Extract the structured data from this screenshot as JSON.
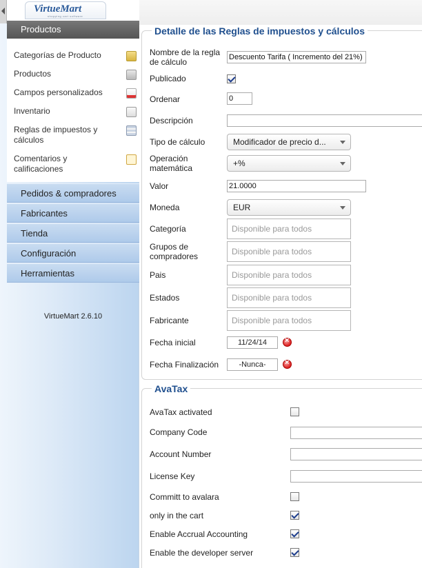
{
  "brand": {
    "name": "VirtueMart",
    "tagline": "shopping cart software"
  },
  "sidebar": {
    "section": "Productos",
    "submenu": [
      {
        "label": "Categorías de Producto",
        "icon": "folder-icon"
      },
      {
        "label": "Productos",
        "icon": "camera-icon"
      },
      {
        "label": "Campos personalizados",
        "icon": "custom-fields-icon"
      },
      {
        "label": "Inventario",
        "icon": "chart-icon"
      },
      {
        "label": "Reglas de impuestos y cálculos",
        "icon": "calculator-icon"
      },
      {
        "label": "Comentarios y calificaciones",
        "icon": "comment-bubble-icon"
      }
    ],
    "nav": [
      "Pedidos & compradores",
      "Fabricantes",
      "Tienda",
      "Configuración",
      "Herramientas"
    ],
    "version": "VirtueMart 2.6.10"
  },
  "rules": {
    "legend": "Detalle de las Reglas de impuestos y cálculos",
    "name_label": "Nombre de la regla de cálculo",
    "name_value": "Descuento Tarifa ( Incremento del 21%)",
    "published_label": "Publicado",
    "published": true,
    "order_label": "Ordenar",
    "order_value": "0",
    "description_label": "Descripción",
    "description_value": "",
    "calc_type_label": "Tipo de cálculo",
    "calc_type_value": "Modificador de precio d...",
    "math_op_label": "Operación matemática",
    "math_op_value": "+%",
    "value_label": "Valor",
    "value_value": "21.0000",
    "currency_label": "Moneda",
    "currency_value": "EUR",
    "category_label": "Categoría",
    "shopper_groups_label": "Grupos de compradores",
    "country_label": "Pais",
    "states_label": "Estados",
    "manufacturer_label": "Fabricante",
    "available_placeholder": "Disponible para todos",
    "start_label": "Fecha inicial",
    "start_value": "11/24/14",
    "end_label": "Fecha Finalización",
    "end_value": "-Nunca-"
  },
  "avatax": {
    "legend": "AvaTax",
    "activated_label": "AvaTax activated",
    "activated": false,
    "company_label": "Company Code",
    "account_label": "Account Number",
    "license_label": "License Key",
    "commit_label": "Committ to avalara",
    "commit": false,
    "cart_label": "only in the cart",
    "cart": true,
    "accrual_label": "Enable Accrual Accounting",
    "accrual": true,
    "dev_label": "Enable the developer server",
    "dev": true
  }
}
